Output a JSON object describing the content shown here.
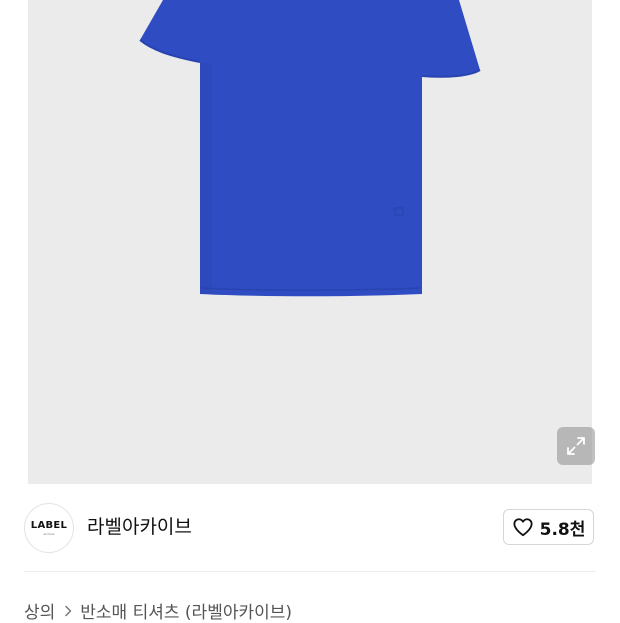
{
  "product": {
    "image_alt": "blue short sleeve t-shirt",
    "shirt_color": "#2f4cc2"
  },
  "icons": {
    "expand": "expand-arrows-icon",
    "like": "heart-outline-icon"
  },
  "seller": {
    "logo_text": "LABEL",
    "logo_subtext": "archive",
    "name": "라벨아카이브",
    "like_count": "5.8천"
  },
  "breadcrumb": {
    "category": "상의",
    "subcategory": "반소매 티셔츠 (라벨아카이브)"
  }
}
